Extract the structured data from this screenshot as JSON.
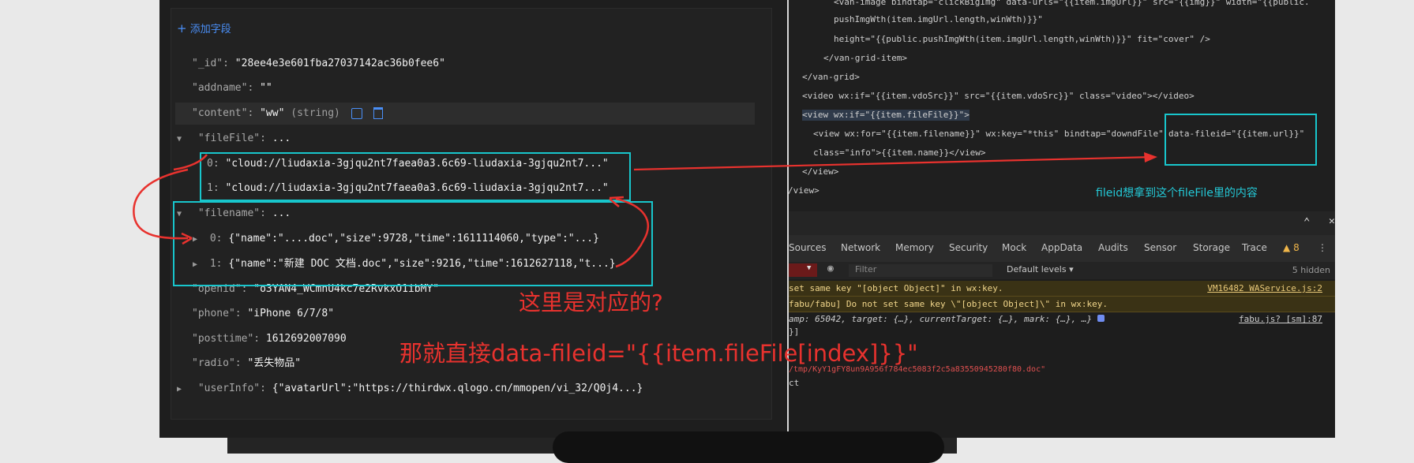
{
  "db": {
    "add_field": "添加字段",
    "rows": {
      "id": {
        "key": "\"_id\":",
        "value": "\"28ee4e3e601fba27037142ac36b0fee6\""
      },
      "addname": {
        "key": "\"addname\":",
        "value": "\"\""
      },
      "content": {
        "key": "\"content\":",
        "value": "\"ww\"",
        "type": "(string)"
      },
      "fileFile": {
        "key": "\"fileFile\":",
        "value": "...",
        "items": [
          {
            "index": "0:",
            "value": "\"cloud://liudaxia-3gjqu2nt7faea0a3.6c69-liudaxia-3gjqu2nt7...\""
          },
          {
            "index": "1:",
            "value": "\"cloud://liudaxia-3gjqu2nt7faea0a3.6c69-liudaxia-3gjqu2nt7...\""
          }
        ]
      },
      "filename": {
        "key": "\"filename\":",
        "value": "...",
        "items": [
          {
            "index": "0:",
            "value": "{\"name\":\"....doc\",\"size\":9728,\"time\":1611114060,\"type\":\"...}"
          },
          {
            "index": "1:",
            "value": "{\"name\":\"新建 DOC 文档.doc\",\"size\":9216,\"time\":1612627118,\"t...}"
          }
        ]
      },
      "openid": {
        "key": "\"openid\":",
        "value": "\"o3YAN4_WCmnU4kc7e2RvkxO1ibMY\""
      },
      "phone": {
        "key": "\"phone\":",
        "value": "\"iPhone 6/7/8\""
      },
      "posttime": {
        "key": "\"posttime\":",
        "value": "1612692007090"
      },
      "radio": {
        "key": "\"radio\":",
        "value": "\"丢失物品\""
      },
      "userInfo": {
        "key": "\"userInfo\":",
        "value": "{\"avatarUrl\":\"https://thirdwx.qlogo.cn/mmopen/vi_32/Q0j4...}"
      }
    }
  },
  "code": {
    "l1": "<van-image bindtap=\"clickBigImg\" data-urls=\"{{item.imgUrl}}\" src=\"{{img}}\" width=\"{{public.",
    "l2": "pushImgWth(item.imgUrl.length,winWth)}}\"",
    "l3": "height=\"{{public.pushImgWth(item.imgUrl.length,winWth)}}\" fit=\"cover\" />",
    "l4": "</van-grid-item>",
    "l5": "</van-grid>",
    "l6": "<video wx:if=\"{{item.vdoSrc}}\" src=\"{{item.vdoSrc}}\" class=\"video\"></video>",
    "l7": "<view  wx:if=\"{{item.fileFile}}\">",
    "l8a": "<view wx:for=\"{{item.filename}}\" wx:key=\"*this\" bindtap=\"downdFile\"",
    "l8b": "data-fileid=\"{{item.url}}\"",
    "l9": "class=\"info\">{{item.name}}</view>",
    "l10": "</view>",
    "l11": "/view>"
  },
  "devtools": {
    "tabs": [
      "Sources",
      "Network",
      "Memory",
      "Security",
      "Mock",
      "AppData",
      "Audits",
      "Sensor",
      "Storage",
      "Trace"
    ],
    "warn_count": "8",
    "filter_placeholder": "Filter",
    "levels": "Default levels",
    "hidden": "5 hidden",
    "warn1": " set same key \"[object Object]\" in wx:key.",
    "warn1_src": "VM16482 WAService.js:2",
    "warn2": "fabu/fabu] Do not set same key \\\"[object Object]\\\" in wx:key.",
    "log1": "amp: 65042, target: {…}, currentTarget: {…}, mark: {…}, …}",
    "log1_src": "fabu.js? [sm]:87",
    "log2": "}]",
    "log3": "/tmp/KyY1gFY8un9A956f784ec5083f2c5a83550945280f80.doc\"",
    "log4": "ct"
  },
  "annotations": {
    "cyan_note": "fileid想拿到这个fileFile里的内容",
    "red_q": "这里是对应的?",
    "red_answer": "那就直接data-fileid=\"{{item.fileFile[index]}}\""
  },
  "colors": {
    "annotation_red": "#e8322e",
    "annotation_cyan": "#18c6cc",
    "link_blue": "#4a8ff7"
  }
}
